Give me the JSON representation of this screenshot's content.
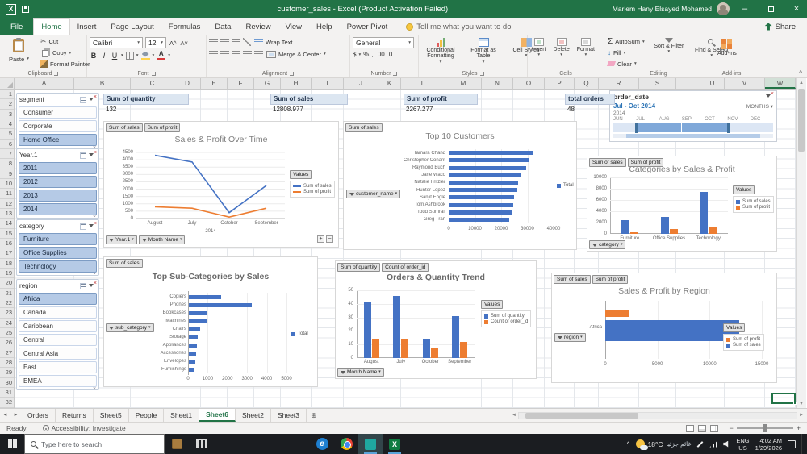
{
  "titlebar": {
    "title": "customer_sales - Excel (Product Activation Failed)",
    "user": "Mariem Hany Elsayed Mohamed"
  },
  "ribbon": {
    "tabs": [
      {
        "label": "File",
        "file": true
      },
      {
        "label": "Home",
        "active": true
      },
      {
        "label": "Insert"
      },
      {
        "label": "Page Layout"
      },
      {
        "label": "Formulas"
      },
      {
        "label": "Data"
      },
      {
        "label": "Review"
      },
      {
        "label": "View"
      },
      {
        "label": "Help"
      },
      {
        "label": "Power Pivot"
      }
    ],
    "tell_me": "Tell me what you want to do",
    "share": "Share",
    "clipboard": {
      "label": "Clipboard",
      "paste": "Paste",
      "cut": "Cut",
      "copy": "Copy",
      "format_painter": "Format Painter"
    },
    "font": {
      "label": "Font",
      "name": "Calibri",
      "size": "12",
      "bold": "B",
      "italic": "I",
      "underline": "U"
    },
    "alignment": {
      "label": "Alignment",
      "wrap": "Wrap Text",
      "merge": "Merge & Center"
    },
    "number": {
      "label": "Number",
      "format": "General",
      "currency": "$",
      "percent": "%",
      "comma": ",",
      "inc_dec": ".00",
      "dec_dec": ".0"
    },
    "styles": {
      "label": "Styles",
      "conditional": "Conditional Formatting",
      "format_table": "Format as Table",
      "cell_styles": "Cell Styles"
    },
    "cells": {
      "label": "Cells",
      "insert": "Insert",
      "delete": "Delete",
      "format": "Format"
    },
    "editing": {
      "label": "Editing",
      "autosum": "AutoSum",
      "fill": "Fill",
      "clear": "Clear",
      "sort": "Sort & Filter",
      "find": "Find & Select"
    },
    "addins": {
      "label": "Add-ins",
      "button": "Add-ins"
    }
  },
  "grid": {
    "columns": [
      "A",
      "B",
      "C",
      "D",
      "E",
      "F",
      "G",
      "H",
      "I",
      "J",
      "K",
      "L",
      "M",
      "N",
      "O",
      "P",
      "Q",
      "R",
      "S",
      "T",
      "U",
      "V",
      "W"
    ],
    "rows": 32,
    "active_column": "W"
  },
  "slicers": [
    {
      "title": "segment",
      "items": [
        {
          "label": "Consumer",
          "selected": false
        },
        {
          "label": "Corporate",
          "selected": false
        },
        {
          "label": "Home Office",
          "selected": true
        }
      ]
    },
    {
      "title": "Year.1",
      "items": [
        {
          "label": "2011",
          "selected": true
        },
        {
          "label": "2012",
          "selected": true
        },
        {
          "label": "2013",
          "selected": true
        },
        {
          "label": "2014",
          "selected": true
        }
      ]
    },
    {
      "title": "category",
      "items": [
        {
          "label": "Furniture",
          "selected": true
        },
        {
          "label": "Office Supplies",
          "selected": true
        },
        {
          "label": "Technology",
          "selected": true
        }
      ]
    },
    {
      "title": "region",
      "items": [
        {
          "label": "Africa",
          "selected": true
        },
        {
          "label": "Canada",
          "selected": false
        },
        {
          "label": "Caribbean",
          "selected": false
        },
        {
          "label": "Central",
          "selected": false
        },
        {
          "label": "Central Asia",
          "selected": false
        },
        {
          "label": "East",
          "selected": false
        },
        {
          "label": "EMEA",
          "selected": false
        }
      ]
    }
  ],
  "metrics": [
    {
      "label": "Sum of quantity",
      "value": "132"
    },
    {
      "label": "Sum of sales",
      "value": "12808.977"
    },
    {
      "label": "Sum of profit",
      "value": "2267.277"
    },
    {
      "label": "total orders",
      "value": "48"
    }
  ],
  "timeline": {
    "title": "order_date",
    "range_label": "Jul - Oct 2014",
    "granularity": "MONTHS",
    "year_label": "2014",
    "months": [
      "JUN",
      "JUL",
      "AUG",
      "SEP",
      "OCT",
      "NOV",
      "DEC"
    ],
    "selected_months": [
      "JUL",
      "AUG",
      "SEP",
      "OCT"
    ]
  },
  "colors": {
    "accent_green": "#217346",
    "series_blue": "#4472c4",
    "series_orange": "#ed7d31"
  },
  "chart_data": [
    {
      "dom": "c1",
      "type": "line",
      "title": "Sales & Profit Over Time",
      "top_buttons": [
        "Sum of sales",
        "Sum of profit"
      ],
      "bottom_buttons": [
        "Year.1",
        "Month Name"
      ],
      "legend_title": "Values",
      "categories": [
        "August",
        "July",
        "October",
        "September"
      ],
      "group_label": "2014",
      "yticks": [
        0,
        500,
        1000,
        1500,
        2000,
        2500,
        3000,
        3500,
        4000,
        4500
      ],
      "series": [
        {
          "name": "Sum of sales",
          "color": "#4472c4",
          "values": [
            4300,
            3850,
            400,
            2250
          ]
        },
        {
          "name": "Sum of profit",
          "color": "#ed7d31",
          "values": [
            800,
            700,
            100,
            700
          ]
        }
      ]
    },
    {
      "dom": "c2",
      "type": "barh",
      "title": "Top 10 Customers",
      "top_buttons": [
        "Sum of sales"
      ],
      "axis_button": "customer_name",
      "legend": [
        "Total"
      ],
      "color": "#4472c4",
      "xmax": 40000,
      "xticks": [
        0,
        10000,
        20000,
        30000,
        40000
      ],
      "categories": [
        "Tamara Chand",
        "Christopher Conant",
        "Raymond Buch",
        "Jane Waco",
        "Natalie Fritzler",
        "Hunter Lopez",
        "Sanjit Engle",
        "Tom Ashbrook",
        "Todd Sumrall",
        "Greg Tran"
      ],
      "values": [
        32000,
        30500,
        29500,
        27500,
        26500,
        26000,
        25000,
        24500,
        24000,
        23000
      ]
    },
    {
      "dom": "c3",
      "type": "column",
      "title": "Categories by Sales & Profit",
      "top_buttons": [
        "Sum of sales",
        "Sum of profit"
      ],
      "axis_button": "category",
      "legend_title": "Values",
      "categories": [
        "Furniture",
        "Office Supplies",
        "Technology"
      ],
      "ymax": 10000,
      "yticks": [
        0,
        2000,
        4000,
        6000,
        8000,
        10000
      ],
      "series": [
        {
          "name": "Sum of sales",
          "color": "#4472c4",
          "values": [
            2450,
            2950,
            7400
          ]
        },
        {
          "name": "Sum of profit",
          "color": "#ed7d31",
          "values": [
            250,
            800,
            1200
          ]
        }
      ]
    },
    {
      "dom": "c4",
      "type": "barh",
      "title": "Top Sub-Categories by Sales",
      "top_buttons": [
        "Sum of sales"
      ],
      "axis_button": "sub_category",
      "legend": [
        "Total"
      ],
      "color": "#4472c4",
      "xmax": 5000,
      "xticks": [
        0,
        1000,
        2000,
        3000,
        4000,
        5000
      ],
      "categories": [
        "Copiers",
        "Phones",
        "Bookcases",
        "Machines",
        "Chairs",
        "Storage",
        "Appliances",
        "Accessories",
        "Envelopes",
        "Furnishings"
      ],
      "values": [
        1700,
        3250,
        1000,
        950,
        600,
        500,
        450,
        400,
        350,
        300
      ]
    },
    {
      "dom": "c5",
      "type": "column",
      "title": "Orders & Quantity Trend",
      "top_buttons": [
        "Sum of quantity",
        "Count of order_id"
      ],
      "axis_button": "Month Name",
      "legend_title": "Values",
      "categories": [
        "August",
        "July",
        "October",
        "September"
      ],
      "ymax": 50,
      "yticks": [
        0,
        10,
        20,
        30,
        40,
        50
      ],
      "series": [
        {
          "name": "Sum of quantity",
          "color": "#4472c4",
          "values": [
            41,
            46,
            14,
            31
          ]
        },
        {
          "name": "Count of order_id",
          "color": "#ed7d31",
          "values": [
            14,
            14,
            8,
            12
          ]
        }
      ]
    },
    {
      "dom": "c6",
      "type": "barh-group",
      "title": "Sales & Profit by Region",
      "top_buttons": [
        "Sum of sales",
        "Sum of profit"
      ],
      "axis_button": "region",
      "legend_title": "Values",
      "categories": [
        "Africa"
      ],
      "xmax": 15000,
      "xticks": [
        0,
        5000,
        10000,
        15000
      ],
      "series": [
        {
          "name": "Sum of profit",
          "color": "#ed7d31",
          "values": [
            2267.277
          ]
        },
        {
          "name": "Sum of sales",
          "color": "#4472c4",
          "values": [
            12808.977
          ]
        }
      ]
    }
  ],
  "sheet_tabs": [
    "Orders",
    "Returns",
    "Sheet5",
    "People",
    "Sheet1",
    "Sheet6",
    "Sheet2",
    "Sheet3"
  ],
  "active_sheet": "Sheet6",
  "status_bar": {
    "mode": "Ready",
    "accessibility": "Accessibility: Investigate"
  },
  "taskbar": {
    "search_placeholder": "Type here to search",
    "icons": [
      "store-icon",
      "task-view-icon",
      "edge-icon",
      "chrome-icon",
      "code-icon",
      "excel-icon"
    ],
    "tray": {
      "temp": "18°C",
      "weather": "غائم جزئيا",
      "lang_top": "ENG",
      "lang_bottom": "US",
      "time": "4:02 AM",
      "date": "1/29/2026"
    }
  }
}
